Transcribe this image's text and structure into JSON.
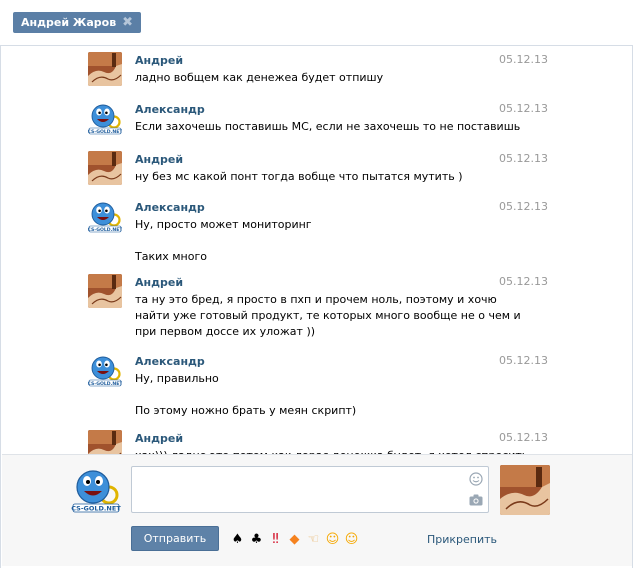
{
  "header": {
    "tab_title": "Андрей Жаров",
    "close_glyph": "✖"
  },
  "messages": [
    {
      "author": "Андрей",
      "date": "05.12.13",
      "avatar": "andrey",
      "lines": [
        "ладно вобщем как денежеа будет отпишу"
      ]
    },
    {
      "author": "Александр",
      "date": "05.12.13",
      "avatar": "alexander",
      "lines": [
        "Если захочешь поставишь МС, если не захочешь то не поставишь"
      ]
    },
    {
      "author": "Андрей",
      "date": "05.12.13",
      "avatar": "andrey",
      "lines": [
        "ну без мс какой понт тогда вобще что пытатся мутить )"
      ]
    },
    {
      "author": "Александр",
      "date": "05.12.13",
      "avatar": "alexander",
      "lines": [
        "Ну, просто может мониторинг",
        "",
        "Таких много"
      ]
    },
    {
      "author": "Андрей",
      "date": "05.12.13",
      "avatar": "andrey",
      "lines": [
        "та ну это бред, я просто в пхп и прочем ноль, поэтому и хочю",
        "найти уже готовый продукт, те которых много вообще не о чем и",
        "при первом доссе их уложат ))"
      ]
    },
    {
      "author": "Александр",
      "date": "05.12.13",
      "avatar": "alexander",
      "lines": [
        "Ну, правильно",
        "",
        "По этому ножно брать у меян скрипт)"
      ]
    },
    {
      "author": "Андрей",
      "date": "05.12.13",
      "avatar": "andrey",
      "lines": [
        "хах))) ладно это потом как лорас денежка будет, я хотел спросить"
      ]
    }
  ],
  "composer": {
    "input_value": "",
    "send_label": "Отправить",
    "attach_label": "Прикрепить",
    "emojis": [
      {
        "name": "spade",
        "glyph": "♠",
        "color": "#000000"
      },
      {
        "name": "club",
        "glyph": "♣",
        "color": "#000000"
      },
      {
        "name": "double-exclamation",
        "glyph": "‼",
        "color": "#d0021b"
      },
      {
        "name": "diamond",
        "glyph": "◆",
        "color": "#f5821f"
      },
      {
        "name": "pointing-hand",
        "glyph": "☜",
        "color": "#e8b46a"
      },
      {
        "name": "smile",
        "glyph": "☺",
        "color": "#f6a800"
      },
      {
        "name": "blush",
        "glyph": "☺",
        "color": "#f6a800"
      }
    ]
  },
  "colors": {
    "accent": "#5b7fa6",
    "author": "#2b587a",
    "date": "#999999",
    "composer_bg": "#f7f7f7"
  }
}
